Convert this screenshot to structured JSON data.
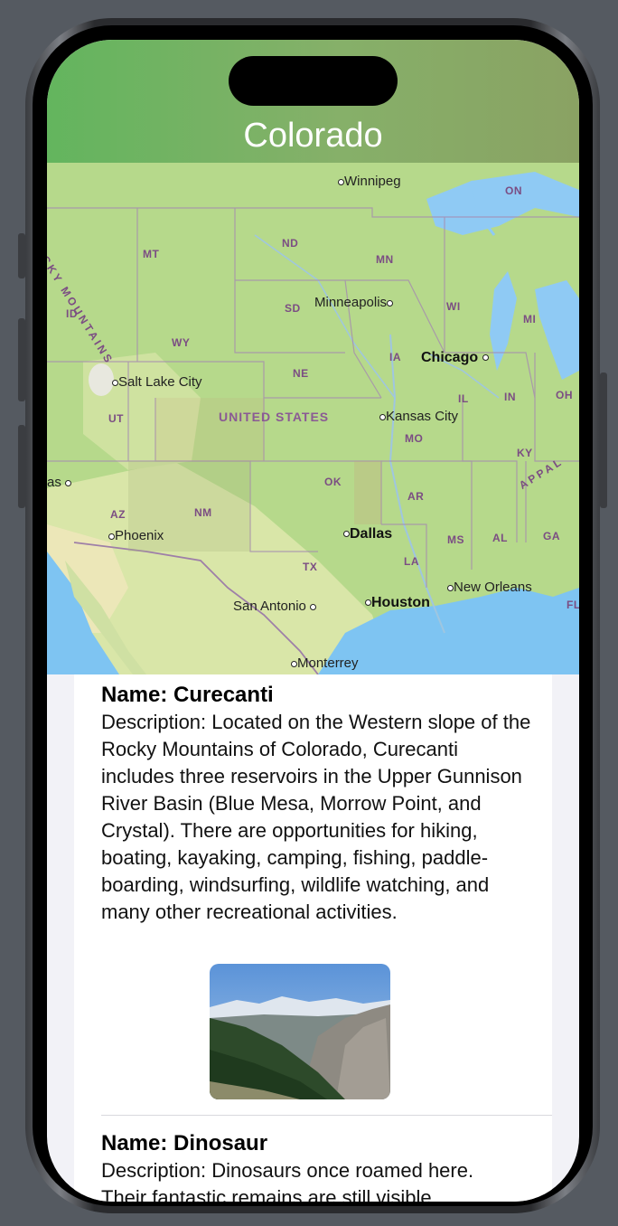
{
  "header": {
    "title": "Colorado"
  },
  "map": {
    "country_label": "UNITED STATES",
    "states": [
      "MT",
      "ND",
      "MN",
      "WI",
      "MI",
      "ID",
      "WY",
      "SD",
      "IA",
      "NE",
      "IL",
      "IN",
      "OH",
      "UT",
      "MO",
      "KY",
      "OK",
      "AR",
      "AZ",
      "NM",
      "TX",
      "MS",
      "AL",
      "GA",
      "LA",
      "FL",
      "ON"
    ],
    "cities": [
      "Winnipeg",
      "Minneapolis",
      "Chicago",
      "Salt Lake City",
      "Kansas City",
      "Phoenix",
      "Dallas",
      "San Antonio",
      "Houston",
      "New Orleans",
      "Monterrey",
      "as"
    ],
    "range_labels": {
      "rockies": "ROCKY MOUNTAINS",
      "appalachians": "APPAL"
    },
    "colors": {
      "land": "#b6d98b",
      "water": "#7ec4f2",
      "desert": "#e8e2b0",
      "border": "#a58bb0"
    }
  },
  "parks": [
    {
      "name": "Name: Curecanti",
      "description": "Description: Located on the Western slope of the Rocky Mountains of Colorado, Curecanti includes three reservoirs in the Upper Gunnison River Basin (Blue Mesa, Morrow Point, and Crystal). There are opportunities for hiking, boating, kayaking, camping, fishing, paddle-boarding, windsurfing, wildlife watching, and many other recreational activities.",
      "photo_icon": "mountain-photo"
    },
    {
      "name": "Name: Dinosaur",
      "description": "Description: Dinosaurs once roamed here.",
      "description_cont": "Their fantastic remains are still visible"
    }
  ]
}
